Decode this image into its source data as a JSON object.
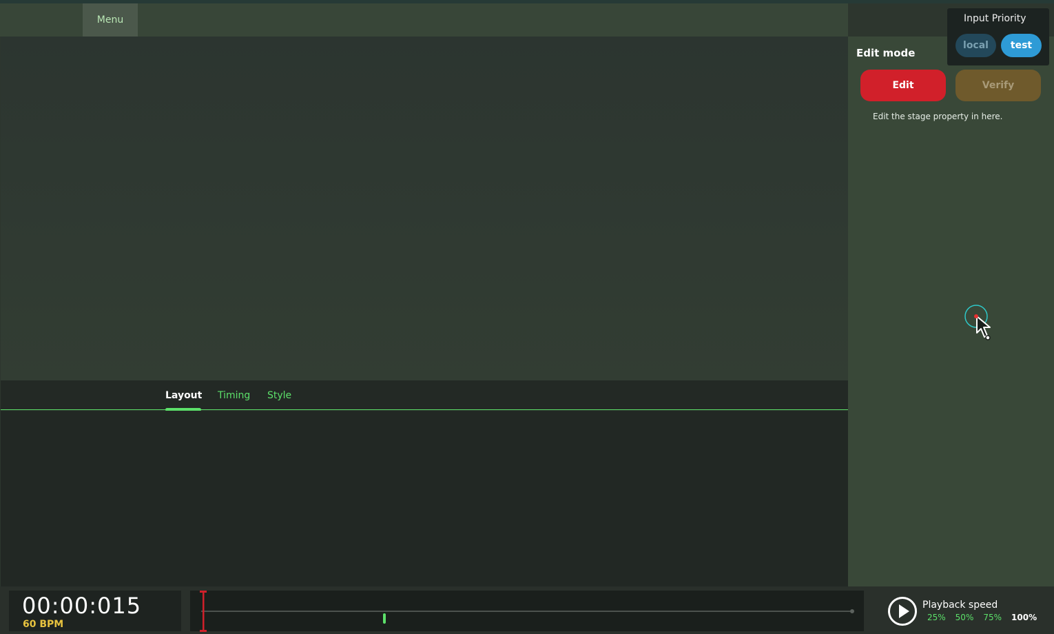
{
  "menubar": {
    "menu_label": "Menu"
  },
  "tabs": [
    {
      "label": "Layout",
      "active": true
    },
    {
      "label": "Timing",
      "active": false
    },
    {
      "label": "Style",
      "active": false
    }
  ],
  "edit_panel": {
    "title": "Edit mode",
    "edit_label": "Edit",
    "verify_label": "Verify",
    "description": "Edit the stage property in here."
  },
  "input_priority": {
    "title": "Input Priority",
    "options": [
      "local",
      "test"
    ],
    "selected": "test"
  },
  "playback": {
    "time": "00:00:015",
    "bpm": "60 BPM",
    "speed_title": "Playback speed",
    "speeds": [
      "25%",
      "50%",
      "75%",
      "100%"
    ],
    "selected_speed": "100%"
  },
  "colors": {
    "accent_green": "#5ce06a",
    "edit_red": "#d1202a",
    "verify_brown": "#6f5a2c",
    "test_blue": "#2e9bd6",
    "bpm_yellow": "#e8c33f"
  },
  "icons": {
    "play": "play-circle-icon",
    "cursor": "mouse-pointer-icon"
  }
}
